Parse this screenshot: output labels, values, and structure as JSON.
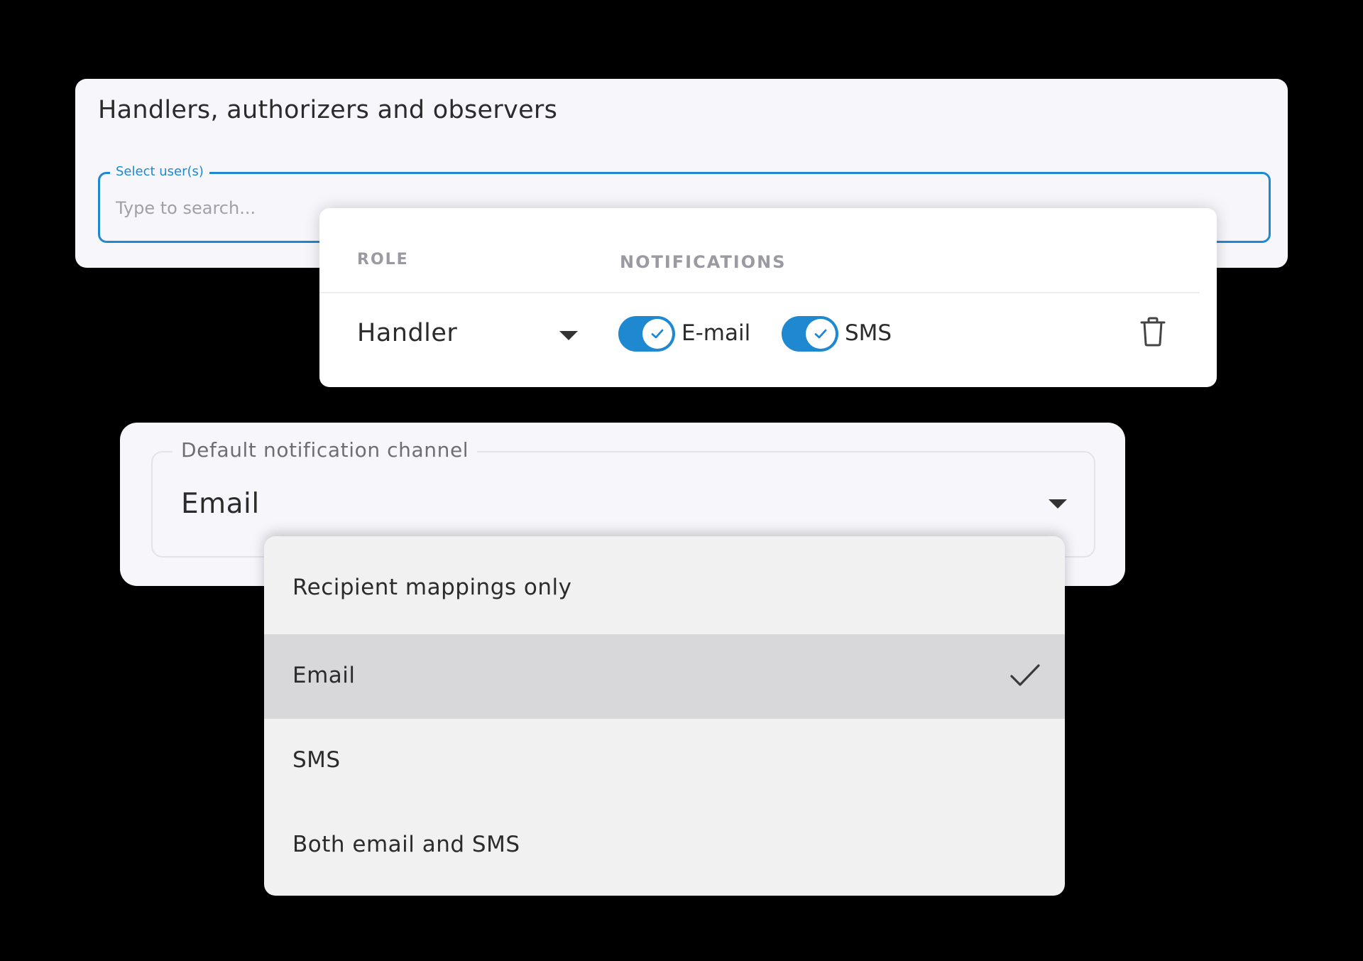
{
  "handlers_card": {
    "title": "Handlers, authorizers and observers",
    "select_users": {
      "label": "Select user(s)",
      "placeholder": "Type to search...",
      "value": ""
    }
  },
  "role_card": {
    "headers": {
      "role": "ROLE",
      "notifications": "NOTIFICATIONS"
    },
    "row": {
      "role_value": "Handler",
      "email_toggle": {
        "label": "E-mail",
        "checked": true
      },
      "sms_toggle": {
        "label": "SMS",
        "checked": true
      },
      "delete_icon": "trash-icon"
    }
  },
  "channel_card": {
    "label": "Default notification channel",
    "value": "Email"
  },
  "channel_menu": {
    "options": [
      {
        "label": "Recipient mappings only",
        "selected": false
      },
      {
        "label": "Email",
        "selected": true
      },
      {
        "label": "SMS",
        "selected": false
      },
      {
        "label": "Both email and SMS",
        "selected": false
      }
    ]
  },
  "colors": {
    "background": "#000000",
    "accent": "#1e88d0",
    "card": "#f7f7fb",
    "menu": "#f1f1f2",
    "menu_selected": "#d8d8db"
  }
}
